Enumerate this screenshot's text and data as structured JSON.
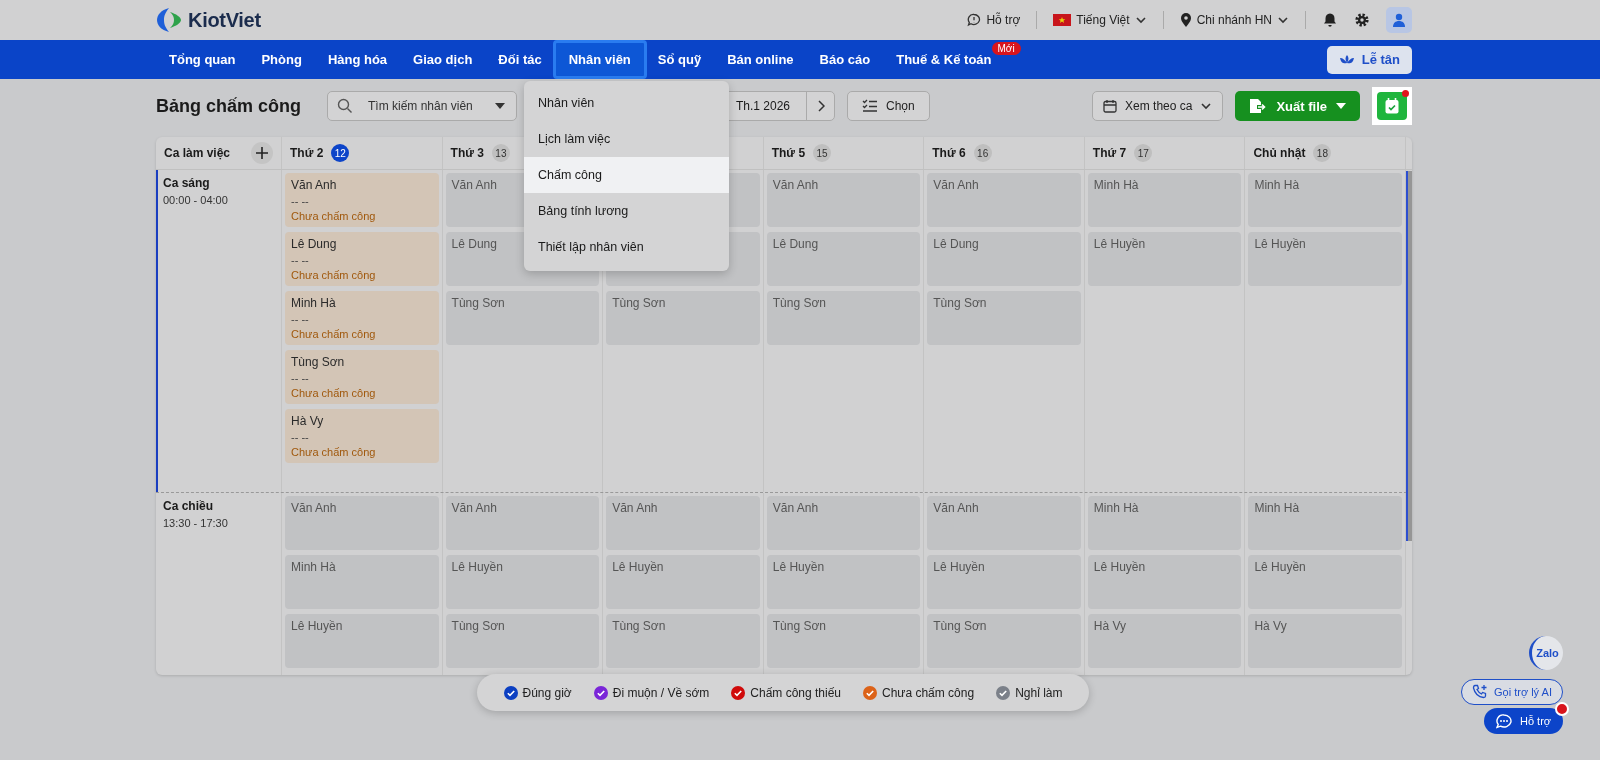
{
  "topbar": {
    "logo": "KiotViet",
    "support": "Hỗ trợ",
    "language": "Tiếng Việt",
    "branch": "Chi nhánh HN"
  },
  "nav": {
    "items": [
      {
        "label": "Tổng quan",
        "selected": false
      },
      {
        "label": "Phòng",
        "selected": false
      },
      {
        "label": "Hàng hóa",
        "selected": false
      },
      {
        "label": "Giao dịch",
        "selected": false
      },
      {
        "label": "Đối tác",
        "selected": false
      },
      {
        "label": "Nhân viên",
        "selected": true
      },
      {
        "label": "Sổ quỹ",
        "selected": false
      },
      {
        "label": "Bán online",
        "selected": false
      },
      {
        "label": "Báo cáo",
        "selected": false
      },
      {
        "label": "Thuế & Kế toán",
        "selected": false,
        "badge": "Mới"
      }
    ],
    "reception_button": "Lễ tân"
  },
  "dropdown": {
    "items": [
      {
        "label": "Nhân viên",
        "selected": false
      },
      {
        "label": "Lịch làm việc",
        "selected": false
      },
      {
        "label": "Chấm công",
        "selected": true
      },
      {
        "label": "Bảng tính lương",
        "selected": false
      },
      {
        "label": "Thiết lập nhân viên",
        "selected": false
      }
    ]
  },
  "toolbar": {
    "title": "Bảng chấm công",
    "search": {
      "placeholder": "Tìm kiếm nhân viên"
    },
    "period": "Th.1 2026",
    "choose_button": "Chọn",
    "view_select": "Xem theo ca",
    "export_button": "Xuất file"
  },
  "schedule": {
    "shift_header": "Ca làm việc",
    "days": [
      {
        "kind": "day",
        "label": "Thứ 2",
        "date": "12",
        "today": true
      },
      {
        "kind": "day",
        "label": "Thứ 3",
        "date": "13",
        "today": false
      },
      {
        "kind": "covered"
      },
      {
        "kind": "day",
        "label": "Thứ 5",
        "date": "15",
        "today": false
      },
      {
        "kind": "day",
        "label": "Thứ 6",
        "date": "16",
        "today": false
      },
      {
        "kind": "day",
        "label": "Thứ 7",
        "date": "17",
        "today": false
      },
      {
        "kind": "day",
        "label": "Chủ nhật",
        "date": "18",
        "today": false
      }
    ],
    "shifts": [
      {
        "name": "Ca sáng",
        "time": "00:00 - 04:00",
        "highlighted": true,
        "cells": [
          [
            {
              "kind": "pending",
              "name": "Văn Anh",
              "clock": "-- --",
              "status": "Chưa chấm công"
            },
            {
              "kind": "pending",
              "name": "Lê Dung",
              "clock": "-- --",
              "status": "Chưa chấm công"
            },
            {
              "kind": "pending",
              "name": "Minh Hà",
              "clock": "-- --",
              "status": "Chưa chấm công"
            },
            {
              "kind": "pending",
              "name": "Tùng Sơn",
              "clock": "-- --",
              "status": "Chưa chấm công"
            },
            {
              "kind": "pending",
              "name": "Hà Vy",
              "clock": "-- --",
              "status": "Chưa chấm công"
            }
          ],
          [
            {
              "kind": "scheduled",
              "name": "Văn Anh"
            },
            {
              "kind": "scheduled",
              "name": "Lê Dung"
            },
            {
              "kind": "scheduled",
              "name": "Tùng Sơn"
            }
          ],
          [
            {
              "kind": "scheduled"
            },
            {
              "kind": "scheduled"
            },
            {
              "kind": "scheduled",
              "name": "Tùng Sơn"
            }
          ],
          [
            {
              "kind": "scheduled",
              "name": "Văn Anh"
            },
            {
              "kind": "scheduled",
              "name": "Lê Dung"
            },
            {
              "kind": "scheduled",
              "name": "Tùng Sơn"
            }
          ],
          [
            {
              "kind": "scheduled",
              "name": "Văn Anh"
            },
            {
              "kind": "scheduled",
              "name": "Lê Dung"
            },
            {
              "kind": "scheduled",
              "name": "Tùng Sơn"
            }
          ],
          [
            {
              "kind": "scheduled",
              "name": "Minh Hà"
            },
            {
              "kind": "scheduled",
              "name": "Lê Huyền"
            }
          ],
          [
            {
              "kind": "scheduled",
              "name": "Minh Hà"
            },
            {
              "kind": "scheduled",
              "name": "Lê Huyền"
            }
          ]
        ]
      },
      {
        "name": "Ca chiều",
        "time": "13:30 - 17:30",
        "highlighted": false,
        "cells": [
          [
            {
              "kind": "scheduled",
              "name": "Văn Anh"
            },
            {
              "kind": "scheduled",
              "name": "Minh Hà"
            },
            {
              "kind": "scheduled",
              "name": "Lê Huyền"
            }
          ],
          [
            {
              "kind": "scheduled",
              "name": "Văn Anh"
            },
            {
              "kind": "scheduled",
              "name": "Lê Huyền"
            },
            {
              "kind": "scheduled",
              "name": "Tùng Sơn"
            }
          ],
          [
            {
              "kind": "scheduled",
              "name": "Văn Anh"
            },
            {
              "kind": "scheduled",
              "name": "Lê Huyền"
            },
            {
              "kind": "scheduled",
              "name": "Tùng Sơn"
            }
          ],
          [
            {
              "kind": "scheduled",
              "name": "Văn Anh"
            },
            {
              "kind": "scheduled",
              "name": "Lê Huyền"
            },
            {
              "kind": "scheduled",
              "name": "Tùng Sơn"
            }
          ],
          [
            {
              "kind": "scheduled",
              "name": "Văn Anh"
            },
            {
              "kind": "scheduled",
              "name": "Lê Huyền"
            },
            {
              "kind": "scheduled",
              "name": "Tùng Sơn"
            }
          ],
          [
            {
              "kind": "scheduled",
              "name": "Minh Hà"
            },
            {
              "kind": "scheduled",
              "name": "Lê Huyền"
            },
            {
              "kind": "scheduled",
              "name": "Hà Vy"
            }
          ],
          [
            {
              "kind": "scheduled",
              "name": "Minh Hà"
            },
            {
              "kind": "scheduled",
              "name": "Lê Huyền"
            },
            {
              "kind": "scheduled",
              "name": "Hà Vy"
            }
          ]
        ]
      }
    ]
  },
  "legend": [
    {
      "label": "Đúng giờ",
      "color": "#0b3fc2"
    },
    {
      "label": "Đi muộn / Về sớm",
      "color": "#7a25d8"
    },
    {
      "label": "Chấm công thiếu",
      "color": "#d00a0a"
    },
    {
      "label": "Chưa chấm công",
      "color": "#dc6218"
    },
    {
      "label": "Nghỉ làm",
      "color": "#7b8089"
    }
  ],
  "floating": {
    "zalo": "Zalo",
    "ai_button": "Gọi trợ lý AI",
    "help_button": "Hỗ trợ"
  }
}
